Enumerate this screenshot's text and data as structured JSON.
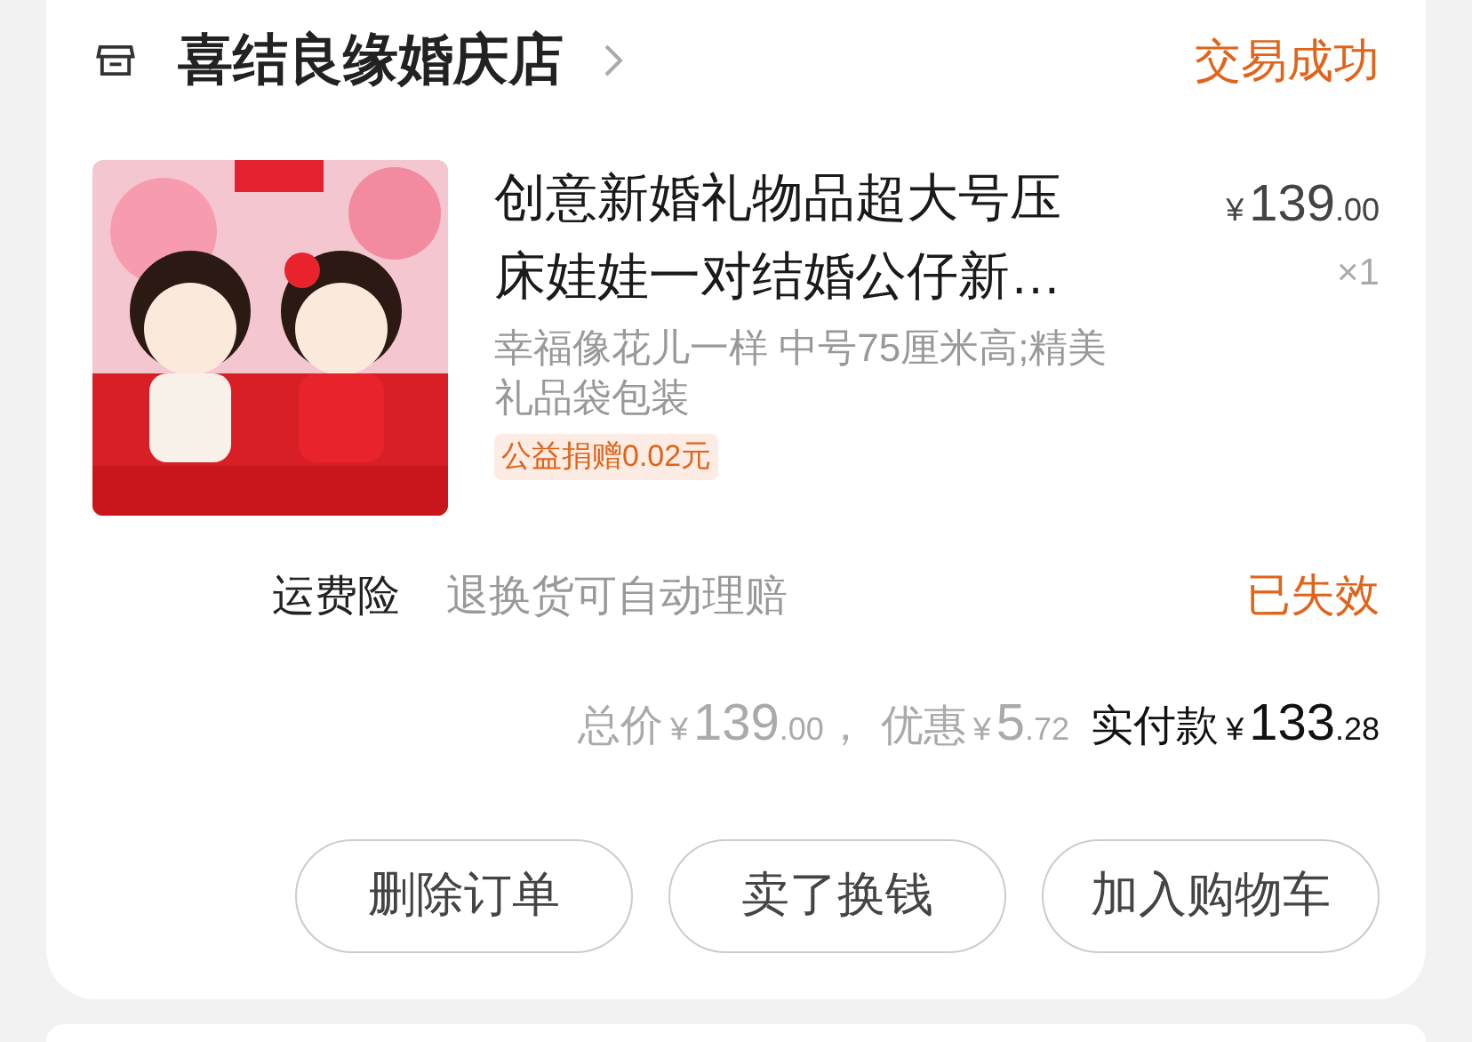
{
  "shop": {
    "name": "喜结良缘婚庆店",
    "status": "交易成功"
  },
  "item": {
    "title": "创意新婚礼物品超大号压床娃娃一对结婚公仔新…",
    "price": {
      "currency": "¥",
      "integer": "139",
      "decimal": ".00"
    },
    "quantity": "×1",
    "spec": "幸福像花儿一样 中号75厘米高;精美礼品袋包装",
    "tag": "公益捐赠0.02元"
  },
  "insurance": {
    "label": "运费险",
    "description": "退换货可自动理赔",
    "status": "已失效"
  },
  "totals": [
    {
      "kind": "muted",
      "label": "总价",
      "currency": "¥",
      "integer": "139",
      "decimal": ".00",
      "separator": "，"
    },
    {
      "kind": "muted",
      "label": "优惠",
      "currency": "¥",
      "integer": "5",
      "decimal": ".72"
    },
    {
      "kind": "strong",
      "label": "实付款",
      "currency": "¥",
      "integer": "133",
      "decimal": ".28"
    }
  ],
  "buttons": [
    "删除订单",
    "卖了换钱",
    "加入购物车"
  ]
}
